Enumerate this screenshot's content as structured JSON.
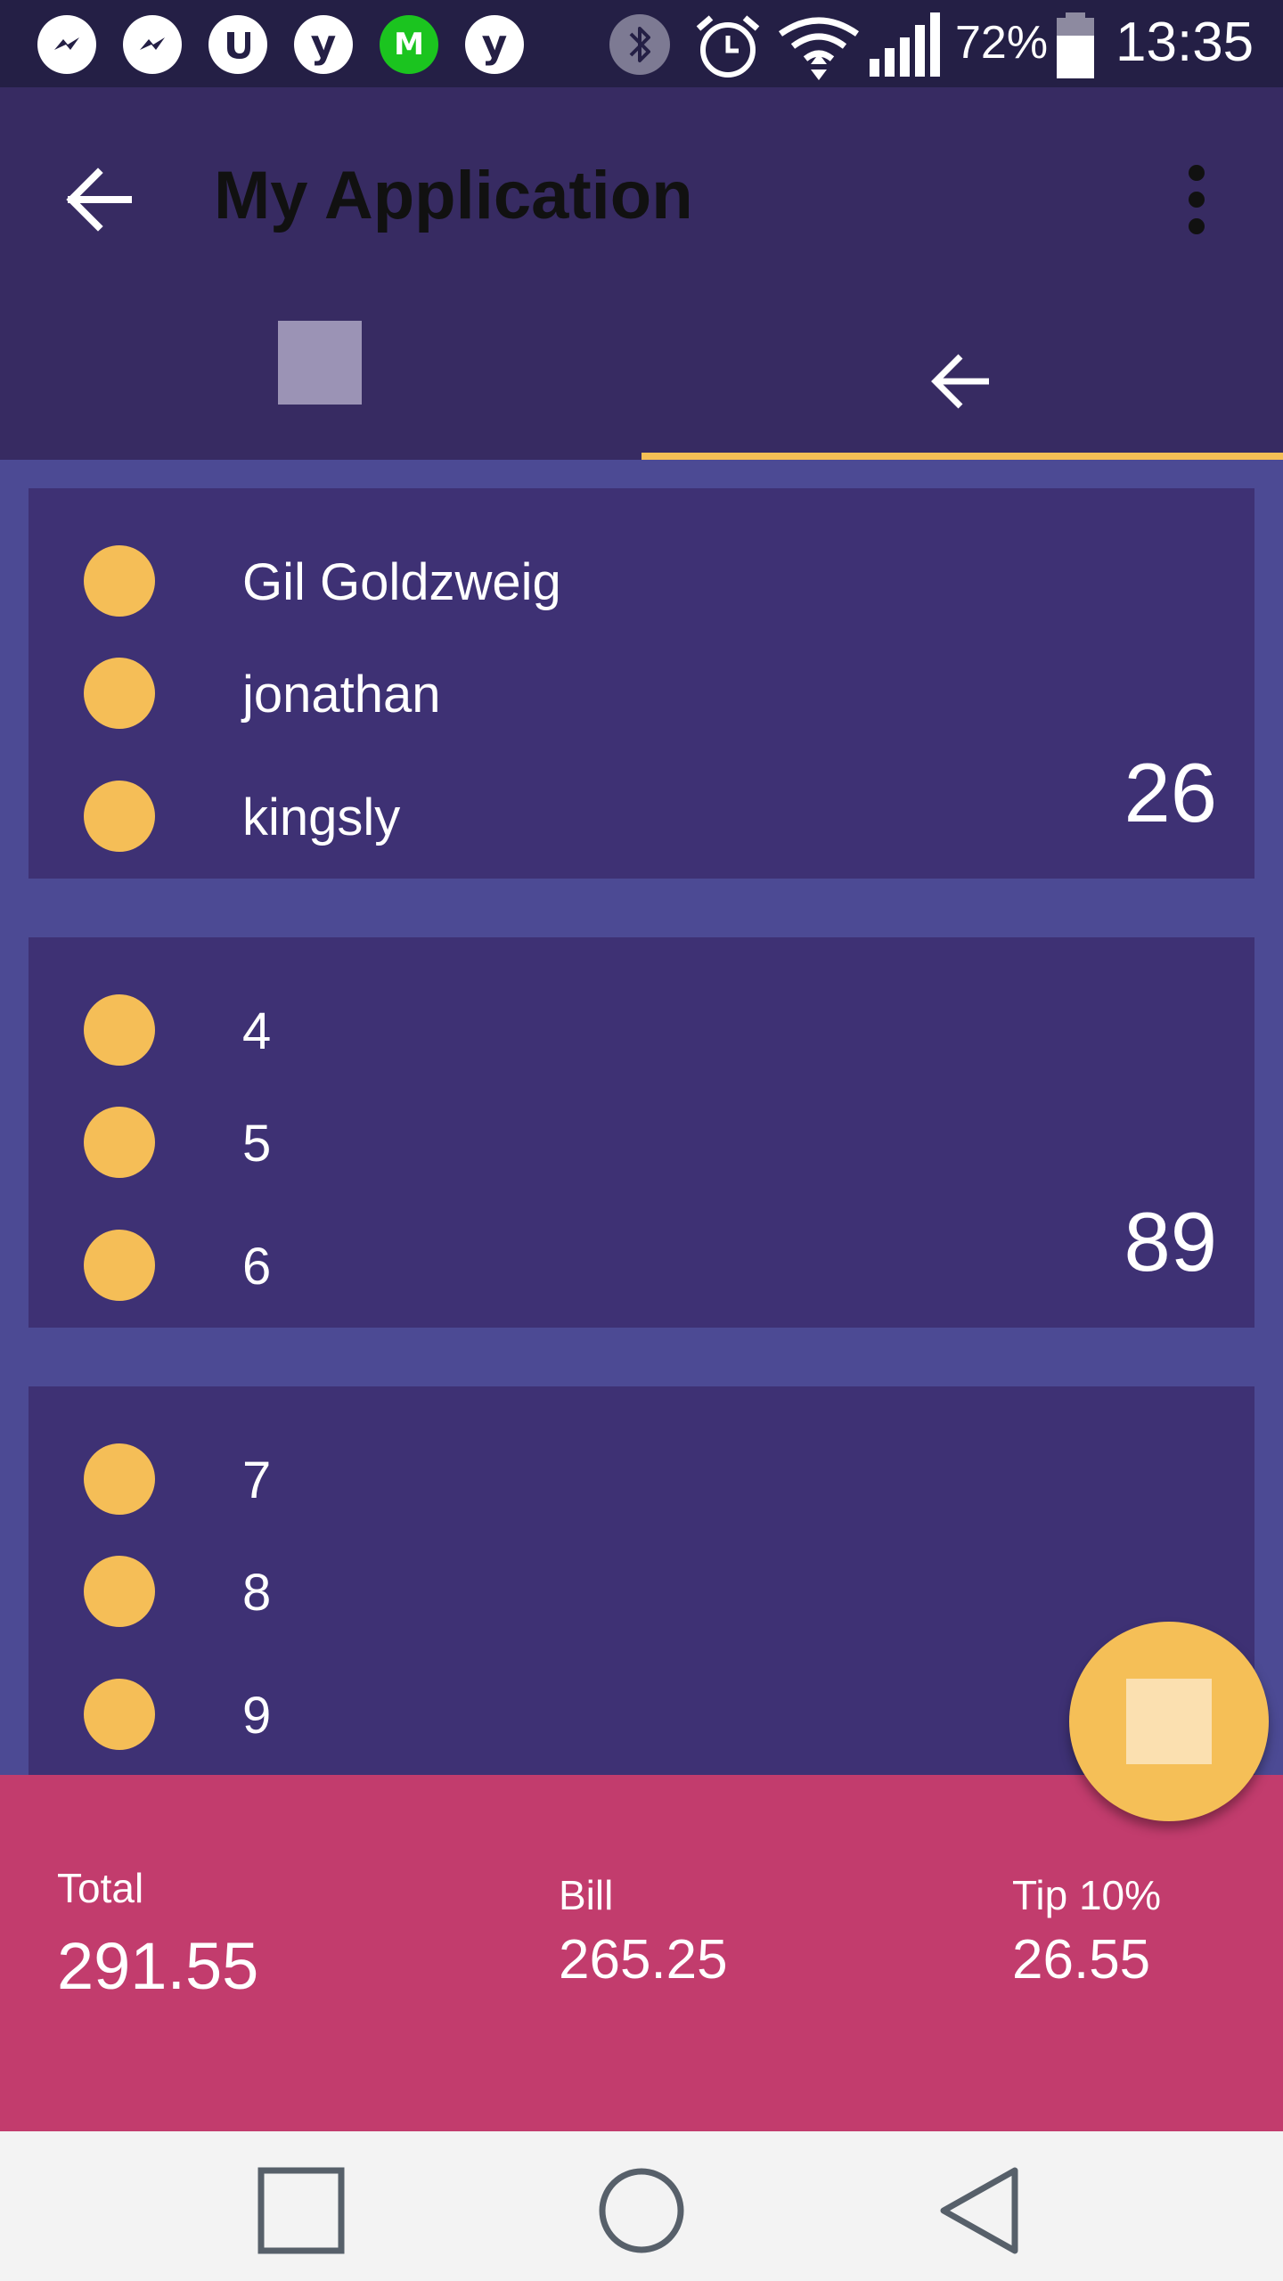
{
  "status_bar": {
    "notification_icons": [
      "messenger-icon",
      "messenger-icon",
      "utorrent-icon",
      "y-icon",
      "m-icon",
      "y-icon"
    ],
    "m_icon_letter": "M",
    "y_icon_letter": "y",
    "system_icons": [
      "bluetooth-icon",
      "alarm-icon",
      "wifi-icon",
      "signal-icon",
      "battery-icon"
    ],
    "battery_percent": "72%",
    "time": "13:35"
  },
  "app_bar": {
    "title": "My Application",
    "tabs": [
      {
        "icon": "square-icon",
        "selected": false
      },
      {
        "icon": "arrow-back-icon",
        "selected": true
      }
    ],
    "accent_color": "#f5bf55"
  },
  "groups": [
    {
      "members": [
        "Gil Goldzweig",
        "jonathan",
        "kingsly"
      ],
      "amount": "26"
    },
    {
      "members": [
        "4",
        "5",
        "6"
      ],
      "amount": "89"
    },
    {
      "members": [
        "7",
        "8",
        "9"
      ],
      "amount": ""
    }
  ],
  "summary": {
    "total_label": "Total",
    "total_value": "291.55",
    "bill_label": "Bill",
    "bill_value": "265.25",
    "tip_label": "Tip 10%",
    "tip_value": "26.55"
  },
  "colors": {
    "status_bar": "#241f45",
    "app_bar": "#372b62",
    "background": "#4c4a94",
    "card": "#3e3174",
    "member_dot": "#f5be57",
    "summary": "#c23c6d",
    "nav_bar": "#f3f3f3"
  },
  "nav_bar": {
    "buttons": [
      "recents-icon",
      "home-icon",
      "back-icon"
    ]
  }
}
